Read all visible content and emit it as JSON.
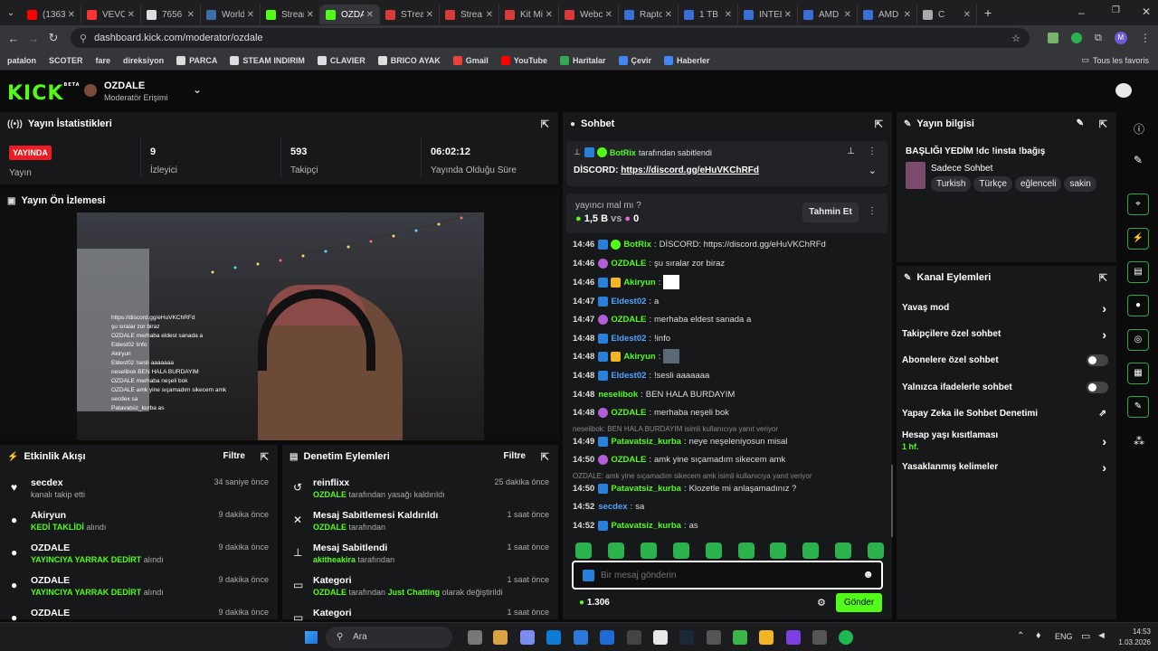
{
  "browser": {
    "tabs": [
      {
        "label": "(1363...",
        "color": "#ff0000"
      },
      {
        "label": "VEVO",
        "color": "#ff3333"
      },
      {
        "label": "7656",
        "color": "#dddddd"
      },
      {
        "label": "World",
        "color": "#3d6fa8"
      },
      {
        "label": "Stream",
        "color": "#53fc18"
      },
      {
        "label": "OZDA",
        "color": "#53fc18",
        "active": true
      },
      {
        "label": "STrea",
        "color": "#d93b3b"
      },
      {
        "label": "Strea",
        "color": "#d93b3b"
      },
      {
        "label": "Kit Mi",
        "color": "#d93b3b"
      },
      {
        "label": "Webc",
        "color": "#d93b3b"
      },
      {
        "label": "Rapto",
        "color": "#3a6fd8"
      },
      {
        "label": "1 TB",
        "color": "#3a6fd8"
      },
      {
        "label": "INTEL",
        "color": "#3a6fd8"
      },
      {
        "label": "AMD",
        "color": "#3a6fd8"
      },
      {
        "label": "AMD",
        "color": "#3a6fd8"
      },
      {
        "label": "C",
        "color": "#aaaaaa"
      }
    ],
    "url": "dashboard.kick.com/moderator/ozdale",
    "bookmarks": [
      "patalon",
      "SCOTER",
      "fare",
      "direksiyon",
      "PARCA",
      "STEAM INDIRIM",
      "CLAVIER",
      "BRICO AYAK",
      "Gmail",
      "YouTube",
      "Haritalar",
      "Çevir",
      "Haberler"
    ],
    "all_bookmarks": "Tous les favoris"
  },
  "header": {
    "logo": "KICK",
    "logo_beta": "BETA",
    "channel_name": "OZDALE",
    "role": "Moderatör Erişimi"
  },
  "stats": {
    "title": "Yayın İstatistikleri",
    "live_badge": "YAYINDA",
    "live_label": "Yayın",
    "viewers": "9",
    "viewers_label": "İzleyici",
    "followers": "593",
    "followers_label": "Takipçi",
    "uptime": "06:02:12",
    "uptime_label": "Yayında Olduğu Süre"
  },
  "preview": {
    "title": "Yayın Ön İzlemesi"
  },
  "activity": {
    "title": "Etkinlik Akışı",
    "filter": "Filtre",
    "items": [
      {
        "name": "secdex",
        "detail_pre": "kanalı takip etti",
        "highlight": "",
        "detail_post": "",
        "time": "34 saniye önce",
        "icon": "♥"
      },
      {
        "name": "Akiryun",
        "detail_pre": "",
        "highlight": "KEDİ TAKLİDİ",
        "detail_post": "alındı",
        "time": "9 dakika önce",
        "icon": "●"
      },
      {
        "name": "OZDALE",
        "detail_pre": "",
        "highlight": "YAYINCIYA YARRAK DEDİRT",
        "detail_post": "alındı",
        "time": "9 dakika önce",
        "icon": "●"
      },
      {
        "name": "OZDALE",
        "detail_pre": "",
        "highlight": "YAYINCIYA YARRAK DEDİRT",
        "detail_post": "alındı",
        "time": "9 dakika önce",
        "icon": "●"
      },
      {
        "name": "OZDALE",
        "detail_pre": "",
        "highlight": "",
        "detail_post": "",
        "time": "9 dakika önce",
        "icon": "●"
      }
    ]
  },
  "moderation": {
    "title": "Denetim Eylemleri",
    "filter": "Filtre",
    "items": [
      {
        "name": "reinflixx",
        "actor": "OZDALE",
        "detail": "tarafından yasağı kaldırıldı",
        "time": "25 dakika önce",
        "icon": "↺"
      },
      {
        "name": "Mesaj Sabitlemesi Kaldırıldı",
        "actor": "OZDALE",
        "detail": "tarafından",
        "time": "1 saat önce",
        "icon": "✕"
      },
      {
        "name": "Mesaj Sabitlendi",
        "actor": "akitheakira",
        "detail": "tarafından",
        "time": "1 saat önce",
        "icon": "⊥"
      },
      {
        "name": "Kategori",
        "actor": "OZDALE",
        "detail": "tarafından",
        "category": "Just Chatting",
        "detail2": "olarak değiştirildi",
        "time": "1 saat önce",
        "icon": "▭"
      },
      {
        "name": "Kategori",
        "actor": "",
        "detail": "",
        "time": "1 saat önce",
        "icon": "▭"
      }
    ]
  },
  "chat": {
    "title": "Sohbet",
    "pinned_by": "BotRix",
    "pinned_by_suffix": "tarafından sabitlendi",
    "pinned_text": "DİSCORD:",
    "pinned_link": "https://discord.gg/eHuVKChRFd",
    "prediction_q": "yayıncı mal mı ?",
    "prediction_left": "1,5 B",
    "prediction_vs": "vs",
    "prediction_right": "0",
    "prediction_btn": "Tahmin Et",
    "messages": [
      {
        "time": "14:46",
        "badges": [
          "mod",
          "ver"
        ],
        "user": "BotRix",
        "color": "#53fc18",
        "text": "DİSCORD: https://discord.gg/eHuVKChRFd"
      },
      {
        "time": "14:46",
        "badges": [
          "host"
        ],
        "user": "OZDALE",
        "color": "#53fc18",
        "text": "şu sıralar zor biraz"
      },
      {
        "time": "14:46",
        "badges": [
          "mod",
          "vip"
        ],
        "user": "Akiryun",
        "color": "#53fc18",
        "text": "[emote]"
      },
      {
        "time": "14:47",
        "badges": [
          "mod"
        ],
        "user": "Eldest02",
        "color": "#4fa3ff",
        "text": "a"
      },
      {
        "time": "14:47",
        "badges": [
          "host"
        ],
        "user": "OZDALE",
        "color": "#53fc18",
        "text": "merhaba eldest sanada a"
      },
      {
        "time": "14:48",
        "badges": [
          "mod"
        ],
        "user": "Eldest02",
        "color": "#4fa3ff",
        "text": "!info"
      },
      {
        "time": "14:48",
        "badges": [
          "mod",
          "vip"
        ],
        "user": "Akiryun",
        "color": "#53fc18",
        "text": "[emote]"
      },
      {
        "time": "14:48",
        "badges": [
          "mod"
        ],
        "user": "Eldest02",
        "color": "#4fa3ff",
        "text": "!sesli aaaaaaa"
      },
      {
        "time": "14:48",
        "badges": [],
        "user": "neselibok",
        "color": "#53fc18",
        "text": "BEN HALA BURDAYIM"
      },
      {
        "time": "14:48",
        "badges": [
          "host"
        ],
        "user": "OZDALE",
        "color": "#53fc18",
        "text": "merhaba neşeli bok"
      },
      {
        "time": "14:49",
        "badges": [
          "mod"
        ],
        "user": "Patavatsiz_kurba",
        "color": "#53fc18",
        "text": "neye neşeleniyosun misal"
      },
      {
        "time": "14:50",
        "badges": [
          "host"
        ],
        "user": "OZDALE",
        "color": "#53fc18",
        "text": "amk yine sıçamadım sikecem amk"
      },
      {
        "time": "14:50",
        "badges": [
          "mod"
        ],
        "user": "Patavatsiz_kurba",
        "color": "#53fc18",
        "text": "Klozetle mi anlaşamadınız ?"
      },
      {
        "time": "14:52",
        "badges": [],
        "user": "secdex",
        "color": "#4fa3ff",
        "text": "sa"
      },
      {
        "time": "14:52",
        "badges": [
          "mod"
        ],
        "user": "Patavatsiz_kurba",
        "color": "#53fc18",
        "text": "as"
      }
    ],
    "reply1": "neselibok: BEN HALA BURDAYIM isimli kullanıcıya yanıt veriyor",
    "reply2": "OZDALE: amk yine sıçamadım sikecem amk isimli kullanıcıya yanıt veriyor",
    "input_placeholder": "Bir mesaj gönderin",
    "points": "1.306",
    "send": "Gönder"
  },
  "stream_info": {
    "title": "Yayın bilgisi",
    "stream_title": "BAŞLIĞI YEDİM !dc !insta !bağış",
    "category": "Sadece Sohbet",
    "tags": [
      "Turkish",
      "Türkçe",
      "eğlenceli",
      "sakin"
    ]
  },
  "channel_actions": {
    "title": "Kanal Eylemleri",
    "slow": "Yavaş mod",
    "followers_only": "Takipçilere özel sohbet",
    "subs_only": "Abonelere özel sohbet",
    "emotes_only": "Yalnızca ifadelerle sohbet",
    "ai_mod": "Yapay Zeka ile Sohbet Denetimi",
    "account_age": "Hesap yaşı kısıtlaması",
    "account_age_value": "1 hf.",
    "banned_words": "Yasaklanmış kelimeler"
  },
  "video_overlay": {
    "lines": [
      "https://discord.gg/eHuVKChRFd",
      "şu sıralar zor biraz",
      "OZDALE merhaba eldest sanada a",
      "Eldest02 !info",
      "Akiryun",
      "Eldest02 !sesli aaaaaaa",
      "neselibok BEN HALA BURDAYIM",
      "OZDALE merhaba neşeli bok",
      "OZDALE amk yine sıçamadım sikecem amk",
      "secdex sa",
      "Patavatsiz_kurba as"
    ]
  },
  "taskbar": {
    "search": "Ara",
    "lang": "ENG",
    "time": "14:53",
    "date": "1.03.2026"
  }
}
